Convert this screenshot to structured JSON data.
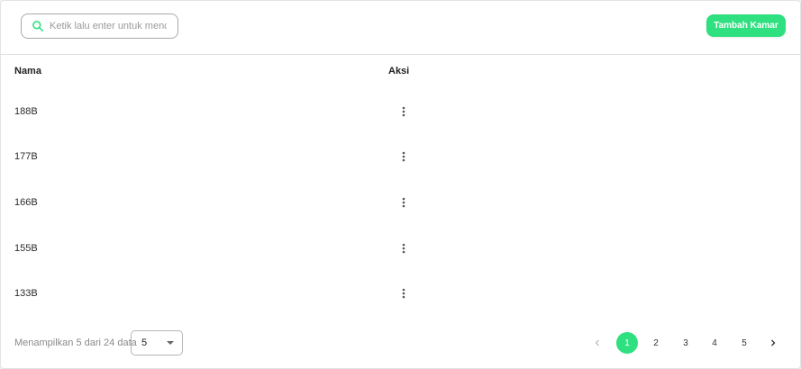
{
  "toolbar": {
    "search_placeholder": "Ketik lalu enter untuk mencari",
    "search_value": "",
    "add_button_label": "Tambah Kamar"
  },
  "table": {
    "columns": [
      "Nama",
      "Aksi"
    ],
    "rows": [
      {
        "name": "188B"
      },
      {
        "name": "177B"
      },
      {
        "name": "166B"
      },
      {
        "name": "155B"
      },
      {
        "name": "133B"
      }
    ]
  },
  "footer": {
    "summary": "Menampilkan 5 dari 24 data",
    "page_size": "5"
  },
  "pagination": {
    "pages": [
      "1",
      "2",
      "3",
      "4",
      "5"
    ],
    "current": "1"
  },
  "colors": {
    "accent": "#2ee07f"
  },
  "icons": {
    "search": "search-icon",
    "row_menu": "more-vert-icon",
    "prev": "chevron-left-icon",
    "next": "chevron-right-icon",
    "dropdown": "caret-down-icon"
  }
}
